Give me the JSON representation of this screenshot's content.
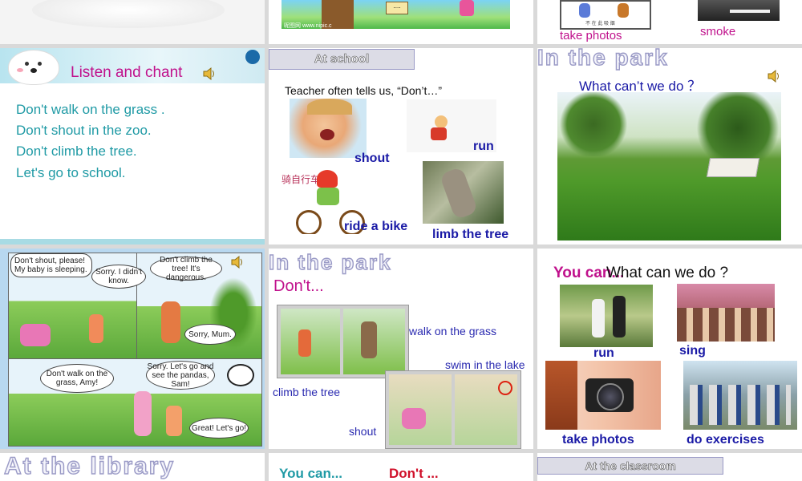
{
  "slide_top_center": {
    "sign": "....",
    "watermark": "昵图网 www.nipic.c"
  },
  "slide_top_right": {
    "label_take_photos": "take photos",
    "label_smoke": "smoke",
    "caption": "不 在 此 吸 烟"
  },
  "slide_listen": {
    "title": "Listen and chant",
    "lines": [
      "Don't walk on the grass .",
      "Don't shout in the zoo.",
      "Don't climb the tree.",
      "Let's go to school."
    ]
  },
  "slide_school": {
    "header": "At school",
    "prompt": "Teacher often tells us, “Don’t…”",
    "label_shout": "shout",
    "label_run": "run",
    "label_ride": "ride a bike",
    "label_climb": "limb the tree",
    "chinese_text": "骑自行车"
  },
  "slide_park_top": {
    "title": "In the park",
    "question": "What can’t we do ？"
  },
  "slide_comic": {
    "bubble1": "Don't shout, please! My baby is sleeping.",
    "bubble2": "Sorry. I didn't know.",
    "bubble3": "Don't climb the tree! It's dangerous.",
    "bubble4": "Sorry, Mum.",
    "bubble5": "Don't walk on the grass, Amy!",
    "bubble6": "Sorry. Let's go and see the pandas, Sam!",
    "bubble7": "Great! Let's go!"
  },
  "slide_park_dont": {
    "title": "In the park",
    "subtitle": "Don't...",
    "label_walk": "walk on the grass",
    "label_swim": "swim in the lake",
    "label_climb": "climb the tree",
    "label_shout": "shout"
  },
  "slide_can": {
    "overlap_title": "You can...",
    "question": "What can we do ?",
    "label_run": "run",
    "label_sing": "sing",
    "label_photos": "take photos",
    "label_exercises": "do exercises"
  },
  "slide_library": {
    "title": "At the library"
  },
  "slide_bottom_center": {
    "can": "You can...",
    "dont": "Don't ..."
  },
  "slide_classroom": {
    "header": "At the classroom"
  },
  "colors": {
    "teal": "#1f9aa5",
    "magenta": "#c0118c",
    "blue": "#1a1aa6",
    "red": "#d0102a"
  }
}
